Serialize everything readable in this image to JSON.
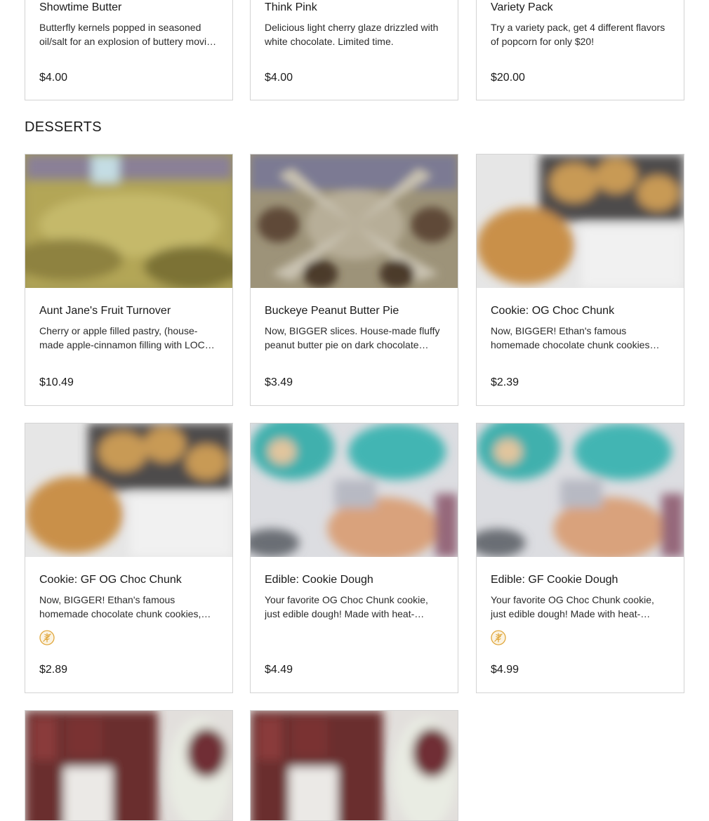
{
  "top_row": [
    {
      "title": "Showtime Butter",
      "description": "Butterfly kernels popped in seasoned oil/salt for an explosion of buttery movie theater flavor.",
      "price": "$4.00"
    },
    {
      "title": "Think Pink",
      "description": "Delicious light cherry glaze drizzled with white chocolate. Limited time.",
      "price": "$4.00"
    },
    {
      "title": "Variety Pack",
      "description": "Try a variety pack, get 4 different flavors of popcorn for only $20!",
      "price": "$20.00"
    }
  ],
  "desserts": {
    "heading": "DESSERTS",
    "items": [
      {
        "title": "Aunt Jane's Fruit Turnover",
        "description": "Cherry or apple filled pastry, (house-made apple-cinnamon filling with LOCAL apples).",
        "price": "$10.49"
      },
      {
        "title": "Buckeye Peanut Butter Pie",
        "description": "Now, BIGGER slices. House-made fluffy peanut butter pie on dark chocolate crust.",
        "price": "$3.49"
      },
      {
        "title": "Cookie: OG Choc Chunk",
        "description": "Now, BIGGER! Ethan's famous homemade chocolate chunk cookies baked fresh.",
        "price": "$2.39"
      },
      {
        "title": "Cookie: GF OG Choc Chunk",
        "description": "Now, BIGGER! Ethan's famous homemade chocolate chunk cookies, gluten free.",
        "price": "$2.89",
        "badge": "gluten-free-icon"
      },
      {
        "title": "Edible: Cookie Dough",
        "description": "Your favorite OG Choc Chunk cookie, just edible dough! Made with heat-treated flour.",
        "price": "$4.49"
      },
      {
        "title": "Edible: GF Cookie Dough",
        "description": "Your favorite OG Choc Chunk cookie, just edible dough! Made with heat-treated gluten free flour.",
        "price": "$4.99",
        "badge": "gluten-free-icon"
      }
    ]
  },
  "colors": {
    "badge": "#e0a63a",
    "border": "#d3d3d3",
    "text": "#1a1a1a"
  }
}
